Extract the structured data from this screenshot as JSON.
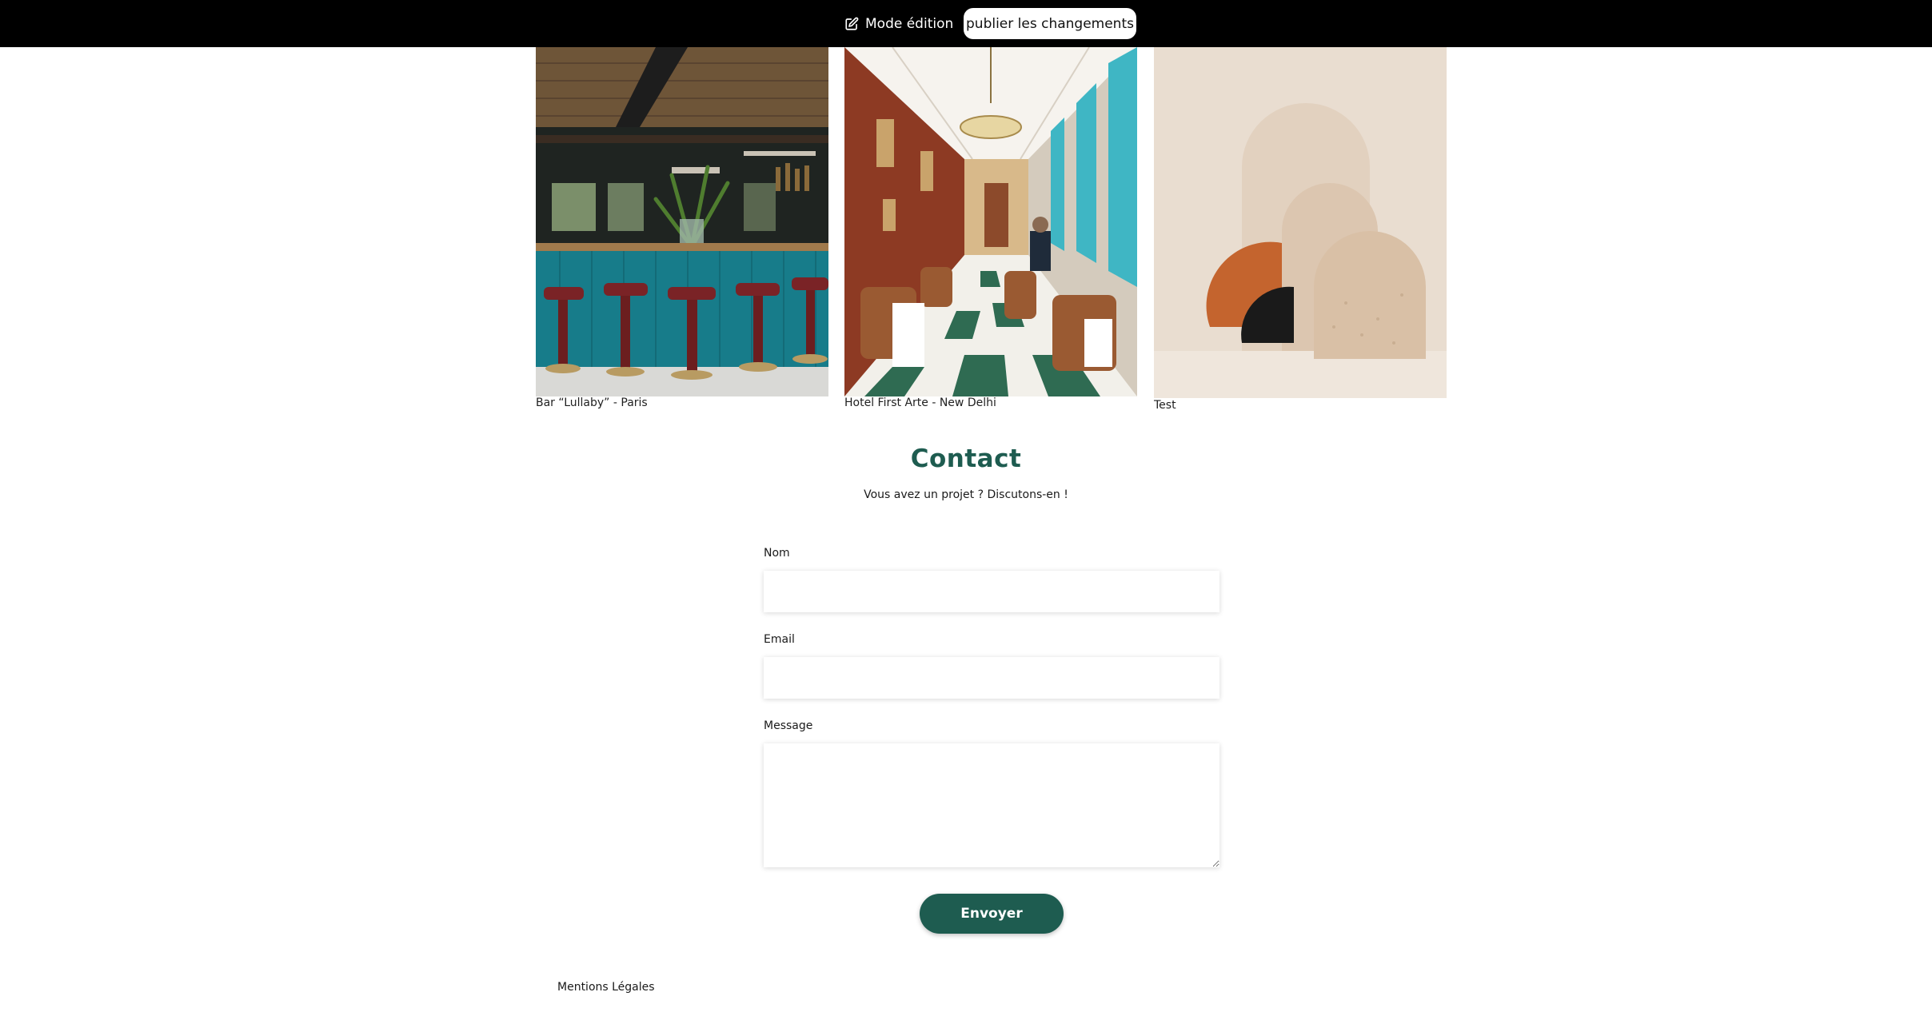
{
  "admin_bar": {
    "mode_label": "Mode édition",
    "mode_icon": "edit-icon",
    "publish_label": "publier les changements"
  },
  "gallery": [
    {
      "caption": "Bar “Lullaby” - Paris"
    },
    {
      "caption": "Hotel First Arte - New Delhi"
    },
    {
      "caption": "Test"
    }
  ],
  "contact": {
    "title": "Contact",
    "subtitle": "Vous avez un projet ? Discutons-en !",
    "fields": {
      "name_label": "Nom",
      "name_value": "",
      "email_label": "Email",
      "email_value": "",
      "message_label": "Message",
      "message_value": ""
    },
    "submit_label": "Envoyer"
  },
  "footer": {
    "legal_label": "Mentions Légales"
  },
  "colors": {
    "accent": "#1e5c50",
    "topbar": "#000000"
  }
}
